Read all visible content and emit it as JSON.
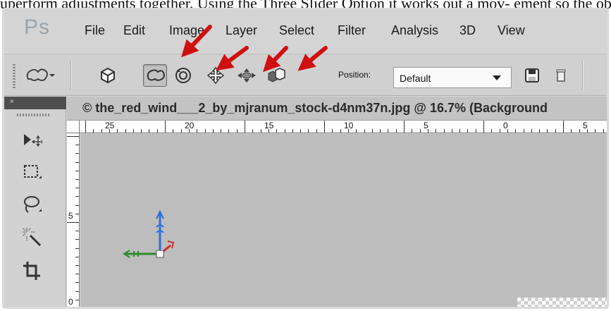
{
  "caption": {
    "text": "uperform adjustments together. Using the Three Slider Option it works out a mov- ement so the objects can be changed in a unique way."
  },
  "app": {
    "logo": "Ps"
  },
  "menu": {
    "items": [
      {
        "label": "File"
      },
      {
        "label": "Edit"
      },
      {
        "label": "Image"
      },
      {
        "label": "Layer"
      },
      {
        "label": "Select"
      },
      {
        "label": "Filter"
      },
      {
        "label": "Analysis"
      },
      {
        "label": "3D"
      },
      {
        "label": "View"
      }
    ]
  },
  "options_bar": {
    "position_label": "Position:",
    "position_value": "Default",
    "icons": [
      "3d-rotate-tool-icon",
      "return-to-initial-icon",
      "3d-orbit-icon",
      "3d-roll-icon",
      "3d-pan-icon",
      "3d-slide-icon",
      "3d-scale-icon",
      "save-position-icon",
      "delete-position-icon"
    ]
  },
  "tools_panel": {
    "collapse_label": "»",
    "tools": [
      "move-tool-icon",
      "marquee-tool-icon",
      "lasso-tool-icon",
      "magic-wand-tool-icon",
      "crop-tool-icon"
    ]
  },
  "document": {
    "title": "© the_red_wind___2_by_mjranum_stock-d4nm37n.jpg @ 16.7% (Background"
  },
  "rulers": {
    "top_labels": [
      "25",
      "20",
      "15",
      "10",
      "5",
      "0",
      "5"
    ],
    "left_labels": [
      "5",
      "0"
    ]
  },
  "colors": {
    "annotation_arrow": "#d01010",
    "axis_x": "#2e8b2e",
    "axis_y": "#2f6fd6",
    "axis_z": "#c9302c"
  }
}
